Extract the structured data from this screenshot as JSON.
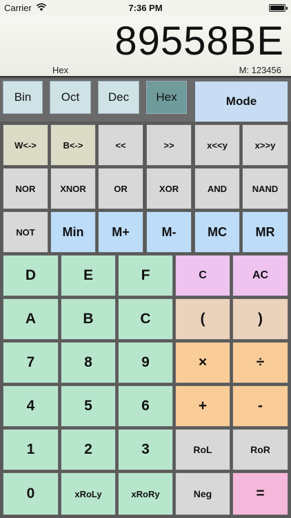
{
  "status": {
    "carrier": "Carrier",
    "time": "7:36 PM"
  },
  "display": {
    "value": "89558BE",
    "mode": "Hex",
    "memory": "M: 123456"
  },
  "bases": [
    "Bin",
    "Oct",
    "Dec",
    "Hex"
  ],
  "active_base": "Hex",
  "mode_label": "Mode",
  "row_shift": [
    "W<->",
    "B<->",
    "<<",
    ">>",
    "x<<y",
    "x>>y"
  ],
  "row_logic": [
    "NOR",
    "XNOR",
    "OR",
    "XOR",
    "AND",
    "NAND"
  ],
  "row_mem": [
    "NOT",
    "Min",
    "M+",
    "M-",
    "MC",
    "MR"
  ],
  "keypad": {
    "row1": [
      "D",
      "E",
      "F",
      "C",
      "AC"
    ],
    "row2": [
      "A",
      "B",
      "C",
      "(",
      ")"
    ],
    "row3": [
      "7",
      "8",
      "9",
      "×",
      "÷"
    ],
    "row4": [
      "4",
      "5",
      "6",
      "+",
      "-"
    ],
    "row5": [
      "1",
      "2",
      "3",
      "RoL",
      "RoR"
    ],
    "row6": [
      "0",
      "xRoLy",
      "xRoRy",
      "Neg",
      "="
    ]
  },
  "colors": {
    "hex_active": "#6f9b9b",
    "digit_green": "#b8e6cd",
    "memory_blue": "#bcdcf8",
    "clear_purple": "#eec3f0",
    "paren_peach": "#ebd2bb",
    "operator_orange": "#f9cc98",
    "equals_pink": "#f6b8da"
  }
}
